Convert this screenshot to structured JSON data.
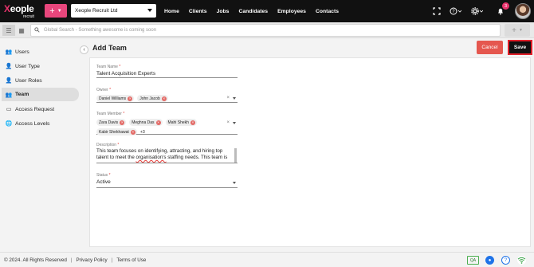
{
  "brand": {
    "name_prefix": "X",
    "name_rest": "eople",
    "sub": "recruit"
  },
  "topbar": {
    "add_icon": "plus-icon",
    "company": "Xeople Recruit Ltd",
    "nav": [
      "Home",
      "Clients",
      "Jobs",
      "Candidates",
      "Employees",
      "Contacts"
    ],
    "notification_count": "3"
  },
  "searchbar": {
    "placeholder": "Global Search - Something awesome is coming soon"
  },
  "sidebar": {
    "items": [
      {
        "label": "Users",
        "icon": "users-icon"
      },
      {
        "label": "User Type",
        "icon": "user-type-icon"
      },
      {
        "label": "User Roles",
        "icon": "user-roles-icon"
      },
      {
        "label": "Team",
        "icon": "team-icon"
      },
      {
        "label": "Access Request",
        "icon": "access-request-icon"
      },
      {
        "label": "Access Levels",
        "icon": "globe-icon"
      }
    ]
  },
  "page": {
    "title": "Add Team",
    "cancel_label": "Cancel",
    "save_label": "Save"
  },
  "form": {
    "team_name": {
      "label": "Team Name",
      "value": "Talent Acquisition Experts"
    },
    "owner": {
      "label": "Owner",
      "chips": [
        "Daniel Williams",
        "John Jacob"
      ]
    },
    "team_member": {
      "label": "Team Member",
      "chips": [
        "Zara Davis",
        "Meghna Das",
        "Mahi Shekh",
        "Kabir Shekhawat"
      ],
      "more": "+3"
    },
    "description": {
      "label": "Description",
      "line1": "This team focuses on identifying, attracting, and hiring top",
      "line2_pre": "talent to meet the ",
      "line2_spell": "organisation's",
      "line2_post": " staffing needs. This team is"
    },
    "status": {
      "label": "Status",
      "value": "Active"
    }
  },
  "footer": {
    "copyright": "© 2024. All Rights Reserved",
    "privacy": "Privacy Policy",
    "terms": "Terms of Use",
    "qa": "QA"
  }
}
